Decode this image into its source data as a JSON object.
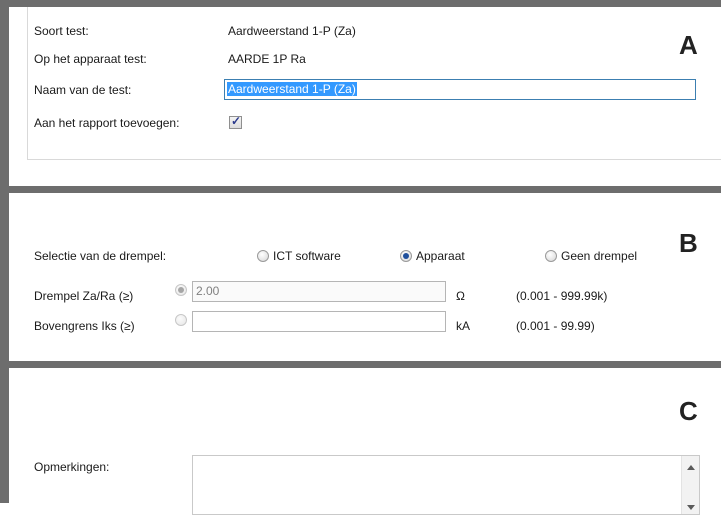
{
  "section_a": {
    "letter": "A",
    "test_type_label": "Soort test:",
    "test_type_value": "Aardweerstand 1-P (Za)",
    "device_test_label": "Op het apparaat test:",
    "device_test_value": "AARDE 1P Ra",
    "test_name_label": "Naam van de test:",
    "test_name_value": "Aardweerstand 1-P (Za)",
    "add_to_report_label": "Aan het rapport toevoegen:",
    "add_to_report_checked": true
  },
  "section_b": {
    "letter": "B",
    "threshold_selection_label": "Selectie van de drempel:",
    "options": [
      {
        "label": "ICT software",
        "selected": false
      },
      {
        "label": "Apparaat",
        "selected": true
      },
      {
        "label": "Geen drempel",
        "selected": false
      }
    ],
    "rows": [
      {
        "label": "Drempel Za/Ra (≥)",
        "value": "2.00",
        "unit": "Ω",
        "range": "(0.001 - 999.99k)",
        "selected": true
      },
      {
        "label": "Bovengrens Iks (≥)",
        "value": "",
        "unit": "kA",
        "range": "(0.001 - 99.99)",
        "selected": false
      }
    ]
  },
  "section_c": {
    "letter": "C",
    "remarks_label": "Opmerkingen:",
    "remarks_value": ""
  }
}
